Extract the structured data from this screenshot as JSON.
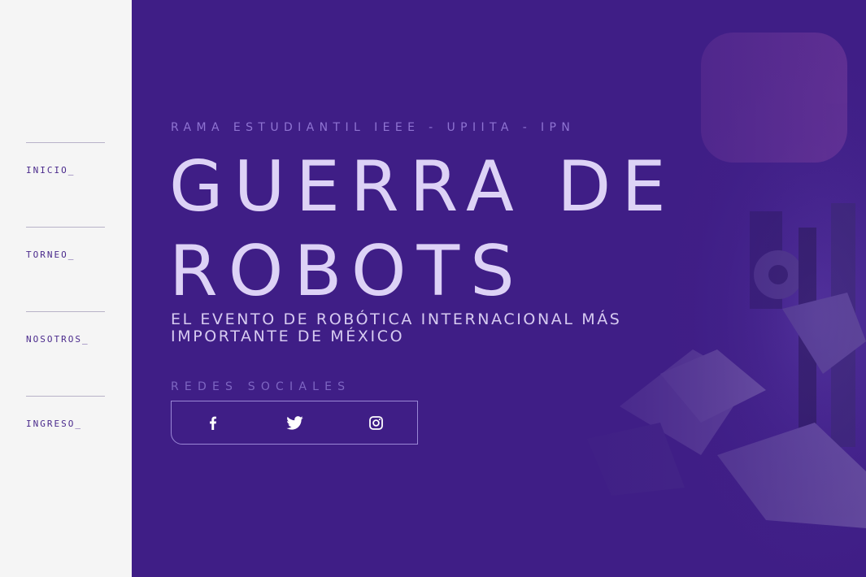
{
  "sidebar": {
    "items": [
      {
        "label": "INICIO_"
      },
      {
        "label": "TORNEO_"
      },
      {
        "label": "NOSOTROS_"
      },
      {
        "label": "INGRESO_"
      }
    ]
  },
  "hero": {
    "kicker": "RAMA ESTUDIANTIL IEEE - UPIITA - IPN",
    "title_line1": "GUERRA DE",
    "title_line2": "ROBOTS",
    "subtitle": "EL EVENTO DE ROBÓTICA INTERNACIONAL MÁS IMPORTANTE DE MÉXICO",
    "social_label": "REDES SOCIALES",
    "social_icons": [
      "facebook-icon",
      "twitter-icon",
      "instagram-icon"
    ]
  },
  "colors": {
    "sidebar_bg": "#f5f5f5",
    "nav_text": "#4a2a8c",
    "hero_bg": "#3f1e86",
    "title_text": "#ddd2f6",
    "muted_text": "#8f74d2"
  }
}
